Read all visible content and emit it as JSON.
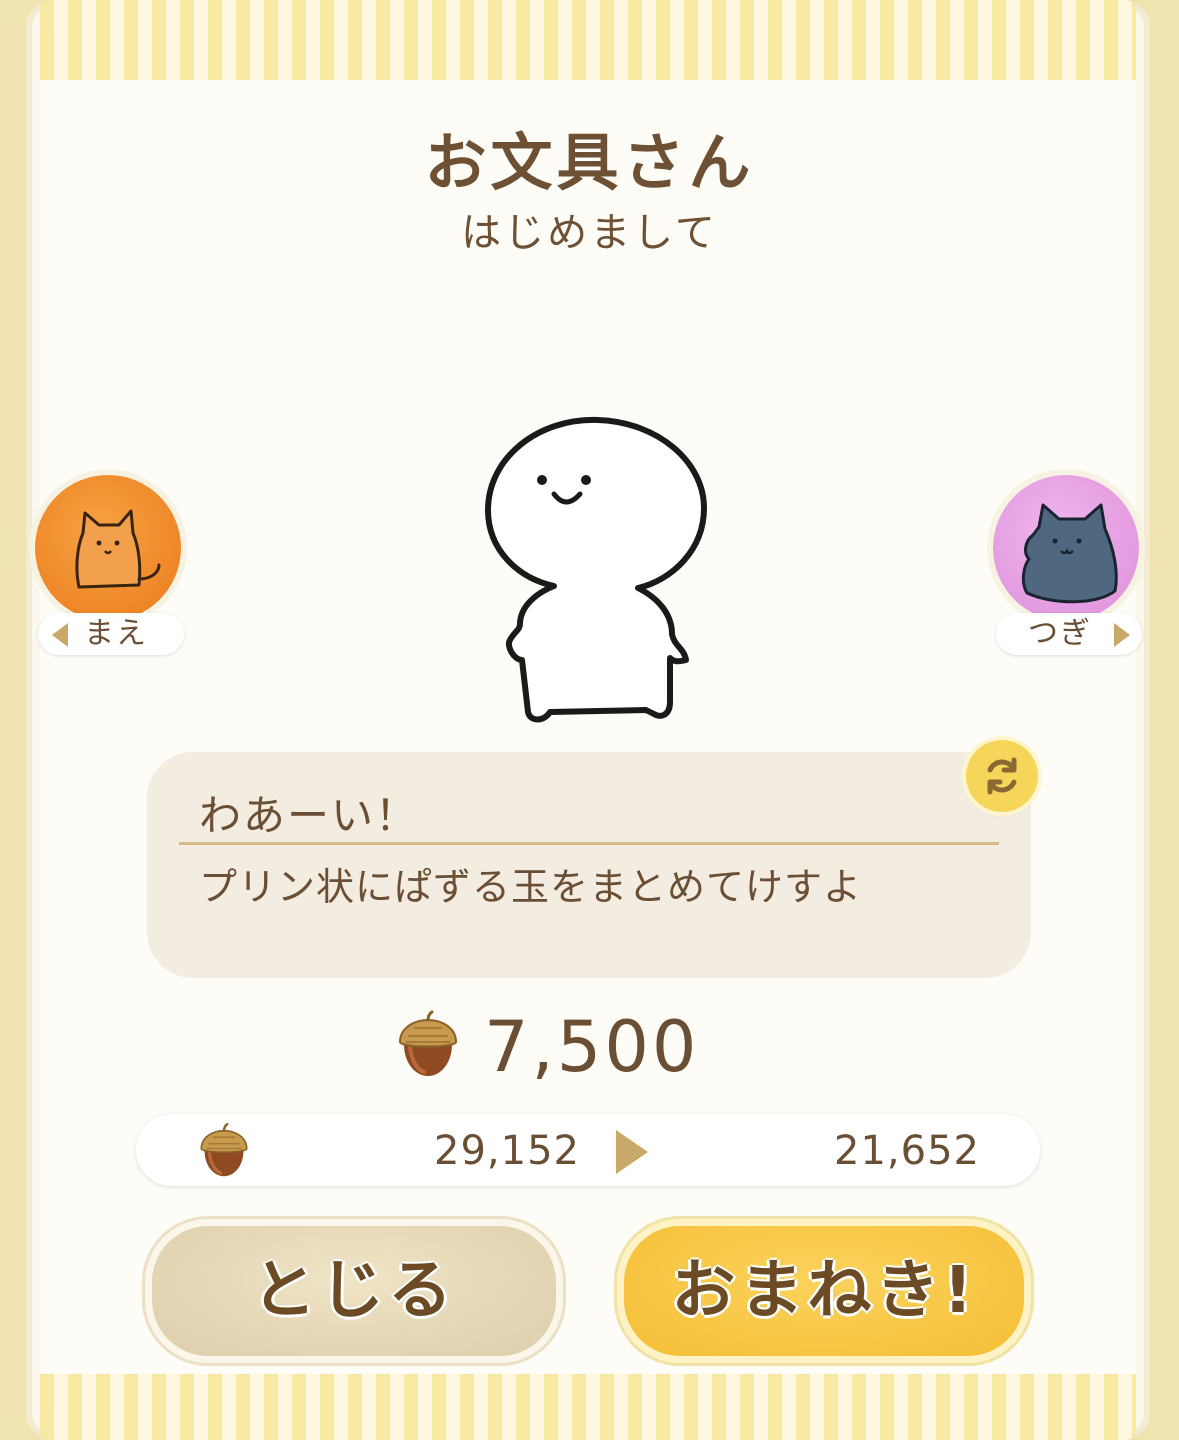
{
  "dialog": {
    "title": "お文具さん",
    "subtitle": "はじめまして"
  },
  "navigation": {
    "prev_label": "まえ",
    "next_label": "つぎ"
  },
  "speech": {
    "name": "わあーい！",
    "line": "プリン状にぱずる玉をまとめてけすよ"
  },
  "cost": {
    "price": "7,500",
    "current_balance": "29,152",
    "balance_after": "21,652",
    "icon": "acorn-icon"
  },
  "buttons": {
    "close_label": "とじる",
    "invite_label": "おまねき!"
  },
  "colors": {
    "text_brown": "#6b4f34",
    "invite_yellow": "#f5be36",
    "close_beige": "#ddceab",
    "stripe_yellow": "#f7e9a2",
    "prev_coin_orange": "#f08c2a",
    "next_coin_pink": "#e39adf"
  }
}
